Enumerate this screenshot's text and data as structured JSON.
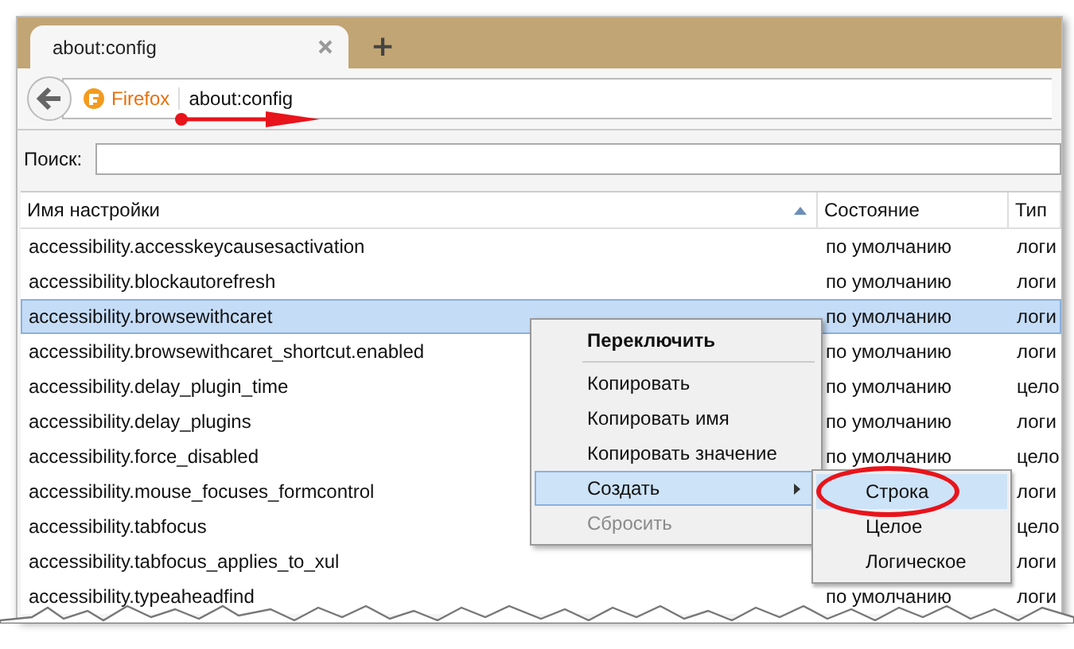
{
  "tabs": [
    {
      "label": "about:config",
      "selected": true
    }
  ],
  "new_tab": "+",
  "nav": {
    "identity": "Firefox",
    "url": "about:config"
  },
  "search": {
    "label": "Поиск:"
  },
  "table": {
    "columns": [
      {
        "label": "Имя настройки",
        "sorted": true
      },
      {
        "label": "Состояние",
        "sorted": false
      },
      {
        "label": "Тип",
        "sorted": false
      }
    ],
    "rows": [
      {
        "name": "accessibility.accesskeycausesactivation",
        "state": "по умолчанию",
        "type": "логи",
        "selected": false
      },
      {
        "name": "accessibility.blockautorefresh",
        "state": "по умолчанию",
        "type": "логи",
        "selected": false
      },
      {
        "name": "accessibility.browsewithcaret",
        "state": "по умолчанию",
        "type": "логи",
        "selected": true
      },
      {
        "name": "accessibility.browsewithcaret_shortcut.enabled",
        "state": "по умолчанию",
        "type": "логи",
        "selected": false
      },
      {
        "name": "accessibility.delay_plugin_time",
        "state": "по умолчанию",
        "type": "цело",
        "selected": false
      },
      {
        "name": "accessibility.delay_plugins",
        "state": "по умолчанию",
        "type": "логи",
        "selected": false
      },
      {
        "name": "accessibility.force_disabled",
        "state": "по умолчанию",
        "type": "цело",
        "selected": false
      },
      {
        "name": "accessibility.mouse_focuses_formcontrol",
        "type": "логи",
        "selected": false
      },
      {
        "name": "accessibility.tabfocus",
        "type": "цело",
        "selected": false
      },
      {
        "name": "accessibility.tabfocus_applies_to_xul",
        "type": "логи",
        "selected": false
      },
      {
        "name": "accessibility.typeaheadfind",
        "state": "по умолчанию",
        "type": "логи",
        "selected": false
      }
    ]
  },
  "context_menu": {
    "items": [
      {
        "kind": "item",
        "label": "Переключить",
        "default": true,
        "disabled": false,
        "selected": false,
        "submenu": false
      },
      {
        "kind": "separator"
      },
      {
        "kind": "item",
        "label": "Копировать",
        "default": false,
        "disabled": false,
        "selected": false,
        "submenu": false
      },
      {
        "kind": "item",
        "label": "Копировать имя",
        "default": false,
        "disabled": false,
        "selected": false,
        "submenu": false
      },
      {
        "kind": "item",
        "label": "Копировать значение",
        "default": false,
        "disabled": false,
        "selected": false,
        "submenu": false
      },
      {
        "kind": "item",
        "label": "Создать",
        "default": false,
        "disabled": false,
        "selected": true,
        "submenu": true
      },
      {
        "kind": "item",
        "label": "Сбросить",
        "default": false,
        "disabled": true,
        "selected": false,
        "submenu": false
      }
    ]
  },
  "submenu": {
    "items": [
      {
        "label": "Строка",
        "selected": true
      },
      {
        "label": "Целое",
        "selected": false
      },
      {
        "label": "Логическое",
        "selected": false
      }
    ]
  }
}
